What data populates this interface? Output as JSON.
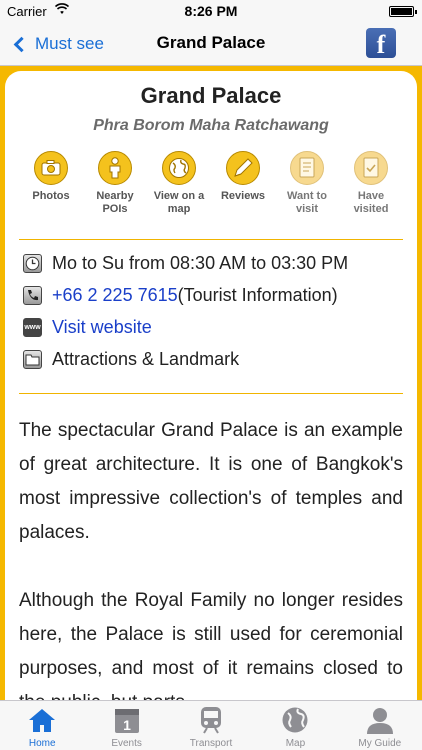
{
  "status_bar": {
    "carrier": "Carrier",
    "time": "8:26 PM",
    "battery_level": 1.0
  },
  "nav": {
    "back_label": "Must see",
    "title": "Grand Palace",
    "share_icon": "facebook-icon"
  },
  "place": {
    "name": "Grand Palace",
    "local_name": "Phra Borom Maha Ratchawang"
  },
  "actions": [
    {
      "label": "Photos",
      "icon": "camera-icon"
    },
    {
      "label": "Nearby POIs",
      "icon": "person-icon"
    },
    {
      "label": "View on a map",
      "icon": "globe-icon"
    },
    {
      "label": "Reviews",
      "icon": "pencil-icon"
    },
    {
      "label": "Want to visit",
      "icon": "document-icon"
    },
    {
      "label": "Have visited",
      "icon": "document-check-icon"
    }
  ],
  "info": {
    "hours": "Mo to Su from 08:30 AM to 03:30 PM",
    "phone_number": "+66 2 225 7615",
    "phone_note": "(Tourist Information)",
    "website_badge": "www",
    "website_label": "Visit website",
    "category": "Attractions & Landmark"
  },
  "description": {
    "paragraph_1": "The spectacular Grand Palace is an example of great architecture. It is one of Bangkok's most impressive collection's of temples and palaces.",
    "paragraph_2": "Although the Royal Family no longer resides here, the Palace is still used for ceremonial purposes, and most of it remains closed to the public, but parts"
  },
  "tabs": [
    {
      "label": "Home",
      "icon": "home-icon",
      "active": true
    },
    {
      "label": "Events",
      "icon": "calendar-icon",
      "active": false
    },
    {
      "label": "Transport",
      "icon": "train-icon",
      "active": false
    },
    {
      "label": "Map",
      "icon": "globe-icon",
      "active": false
    },
    {
      "label": "My Guide",
      "icon": "user-icon",
      "active": false
    }
  ],
  "colors": {
    "accent": "#1a6fd6",
    "theme_yellow": "#f5b800",
    "link": "#1a3fc9",
    "facebook": "#3b5998"
  }
}
